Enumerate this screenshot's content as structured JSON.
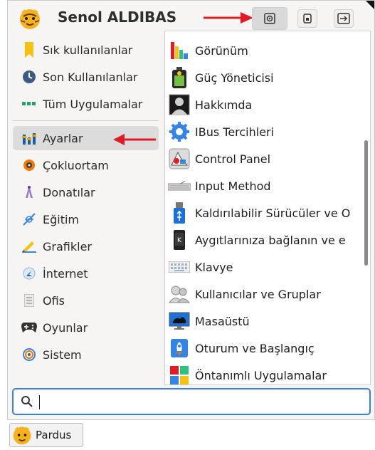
{
  "header": {
    "username": "Senol ALDIBAS"
  },
  "header_buttons": [
    {
      "icon": "lock-screen-icon"
    },
    {
      "icon": "lock-icon"
    },
    {
      "icon": "logout-icon"
    }
  ],
  "categories": [
    {
      "label": "Sık kullanılanlar",
      "icon": "bookmark-icon"
    },
    {
      "label": "Son Kullanılanlar",
      "icon": "clock-icon"
    },
    {
      "label": "Tüm Uygulamalar",
      "icon": "dots-icon"
    },
    {
      "label": "Ayarlar",
      "icon": "settings-icon",
      "selected": true
    },
    {
      "label": "Çokluortam",
      "icon": "multimedia-icon"
    },
    {
      "label": "Donatılar",
      "icon": "accessories-icon"
    },
    {
      "label": "Eğitim",
      "icon": "education-icon"
    },
    {
      "label": "Grafikler",
      "icon": "graphics-icon"
    },
    {
      "label": "İnternet",
      "icon": "internet-icon"
    },
    {
      "label": "Ofis",
      "icon": "office-icon"
    },
    {
      "label": "Oyunlar",
      "icon": "gamepad-icon"
    },
    {
      "label": "Sistem",
      "icon": "system-icon"
    }
  ],
  "apps": [
    {
      "label": "Görünüm",
      "icon": "appearance-icon"
    },
    {
      "label": "Güç Yöneticisi",
      "icon": "power-manager-icon"
    },
    {
      "label": "Hakkımda",
      "icon": "about-me-icon"
    },
    {
      "label": "IBus Tercihleri",
      "icon": "ibus-icon"
    },
    {
      "label": "Control Panel",
      "icon": "control-panel-icon"
    },
    {
      "label": "Input Method",
      "icon": "input-method-icon"
    },
    {
      "label": "Kaldırılabilir Sürücüler ve O",
      "icon": "removable-drives-icon"
    },
    {
      "label": "Aygıtlarınıza bağlanın ve e",
      "icon": "kdeconnect-icon"
    },
    {
      "label": "Klavye",
      "icon": "keyboard-icon"
    },
    {
      "label": "Kullanıcılar ve Gruplar",
      "icon": "users-groups-icon"
    },
    {
      "label": "Masaüstü",
      "icon": "desktop-icon"
    },
    {
      "label": "Oturum ve Başlangıç",
      "icon": "session-startup-icon"
    },
    {
      "label": "Öntanımlı Uygulamalar",
      "icon": "default-apps-icon"
    }
  ],
  "search": {
    "value": "",
    "placeholder": ""
  },
  "taskbar": {
    "label": "Pardus"
  },
  "colors": {
    "accent": "#3c7fd6",
    "arrow": "#e01b24",
    "selected_bg": "#dcdcdc"
  }
}
